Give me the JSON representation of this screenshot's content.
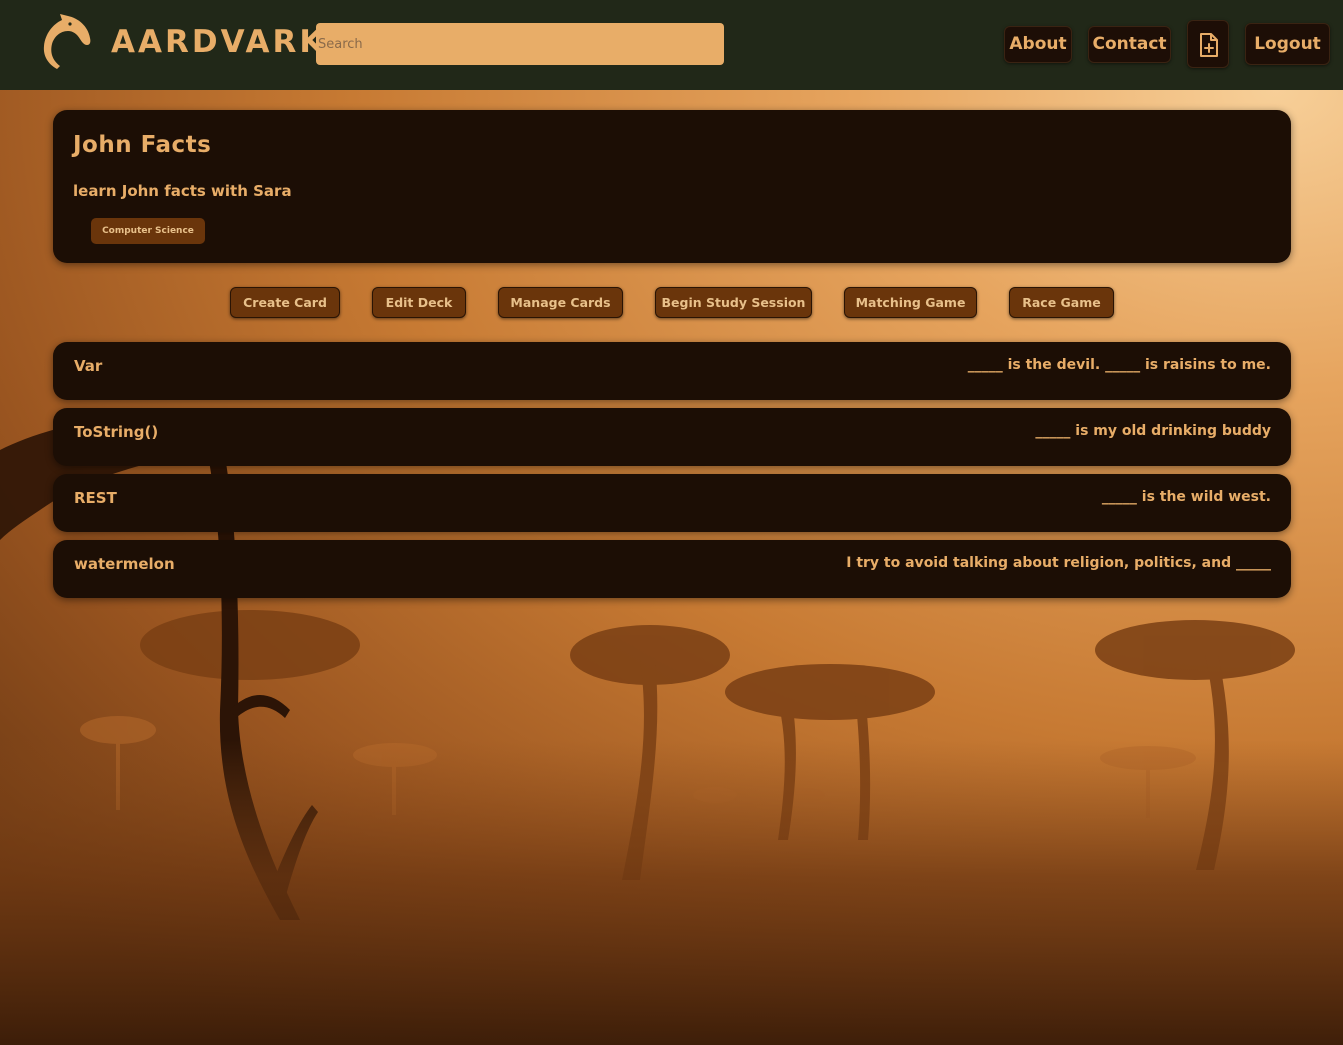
{
  "navbar": {
    "brand": "AARDVARK",
    "search_placeholder": "Search",
    "about_label": "About",
    "contact_label": "Contact",
    "file_icon": "file-add-icon",
    "logout_label": "Logout"
  },
  "deck": {
    "title": "John Facts",
    "description": "learn John facts with Sara",
    "tag": "Computer Science"
  },
  "actions": {
    "create_card": "Create Card",
    "edit_deck": "Edit Deck",
    "manage_cards": "Manage Cards",
    "begin_study": "Begin Study Session",
    "matching_game": "Matching Game",
    "race_game": "Race Game"
  },
  "cards": [
    {
      "term": "Var",
      "definition": "_____ is the devil. _____ is raisins to me."
    },
    {
      "term": "ToString()",
      "definition": "_____ is my old drinking buddy"
    },
    {
      "term": "REST",
      "definition": "_____ is the wild west."
    },
    {
      "term": "watermelon",
      "definition": "I try to avoid talking about religion, politics, and _____"
    }
  ],
  "colors": {
    "navbar_bg": "#212818",
    "accent": "#e8ad68",
    "card_bg": "#1c0e05",
    "button_bg": "#6a350b"
  }
}
